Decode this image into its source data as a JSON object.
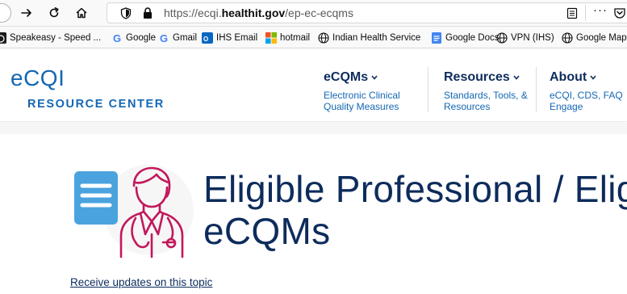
{
  "browser": {
    "url_prefix": "https://ecqi.",
    "url_domain": "healthit.gov",
    "url_path": "/ep-ec-ecqms",
    "bookmarks": [
      {
        "label": "Speakeasy - Speed ...",
        "icon": "speedtest-icon"
      },
      {
        "label": "Google",
        "icon": "google-icon"
      },
      {
        "label": "Gmail",
        "icon": "google-icon"
      },
      {
        "label": "IHS Email",
        "icon": "outlook-icon"
      },
      {
        "label": "hotmail",
        "icon": "microsoft-icon"
      },
      {
        "label": "Indian Health Service",
        "icon": "globe-icon"
      },
      {
        "label": "Google Docs",
        "icon": "docs-icon"
      },
      {
        "label": "VPN (IHS)",
        "icon": "globe-icon"
      },
      {
        "label": "Google Maps",
        "icon": "globe-icon"
      }
    ]
  },
  "site": {
    "logo_main": "eCQI",
    "logo_sub": "RESOURCE CENTER",
    "nav": [
      {
        "title": "eCQMs",
        "sub1": "Electronic Clinical",
        "sub2": "Quality Measures"
      },
      {
        "title": "Resources",
        "sub1": "Standards, Tools, &",
        "sub2": "Resources"
      },
      {
        "title": "About",
        "sub1": "eCQI, CDS, FAQ",
        "sub2": "Engage"
      }
    ]
  },
  "page": {
    "title_line1": "Eligible Professional / Elig",
    "title_line2": "eCQMs",
    "updates_link": "Receive updates on this topic"
  },
  "colors": {
    "navy": "#0d2c5c",
    "brand_blue": "#1467b3",
    "icon_blue": "#4aa3df",
    "icon_magenta": "#c2185b"
  }
}
